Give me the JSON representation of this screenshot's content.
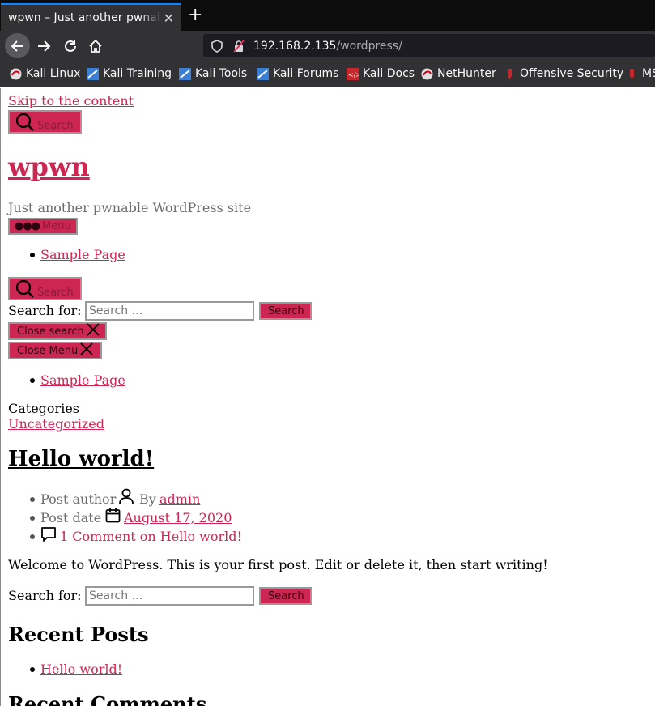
{
  "browser": {
    "tab_title": "wpwn – Just another pwnable WordPress site",
    "url_host": "192.168.2.135",
    "url_path": "/wordpress/",
    "bookmarks": [
      "Kali Linux",
      "Kali Training",
      "Kali Tools",
      "Kali Forums",
      "Kali Docs",
      "NetHunter",
      "Offensive Security",
      "MS"
    ]
  },
  "page": {
    "skip_link": "Skip to the content",
    "search_toggle_label": "Search",
    "site_title": "wpwn",
    "site_description": "Just another pwnable WordPress site",
    "menu_label": "Menu",
    "nav_items": [
      "Sample Page"
    ],
    "search_toggle_label_2": "Search",
    "search_form": {
      "label": "Search for:",
      "placeholder": "Search …",
      "submit": "Search"
    },
    "close_search": "Close search",
    "close_menu": "Close Menu",
    "modal_nav_items": [
      "Sample Page"
    ],
    "categories_label": "Categories",
    "category": "Uncategorized",
    "post": {
      "title": "Hello world!",
      "author_label": "Post author",
      "by": "By",
      "author": "admin",
      "date_label": "Post date",
      "date": "August 17, 2020",
      "comments": "1 Comment on Hello world!",
      "content": "Welcome to WordPress. This is your first post. Edit or delete it, then start writing!"
    },
    "footer_search": {
      "label": "Search for:",
      "placeholder": "Search …",
      "submit": "Search"
    },
    "recent_posts_title": "Recent Posts",
    "recent_posts": [
      "Hello world!"
    ],
    "recent_comments_title": "Recent Comments"
  }
}
